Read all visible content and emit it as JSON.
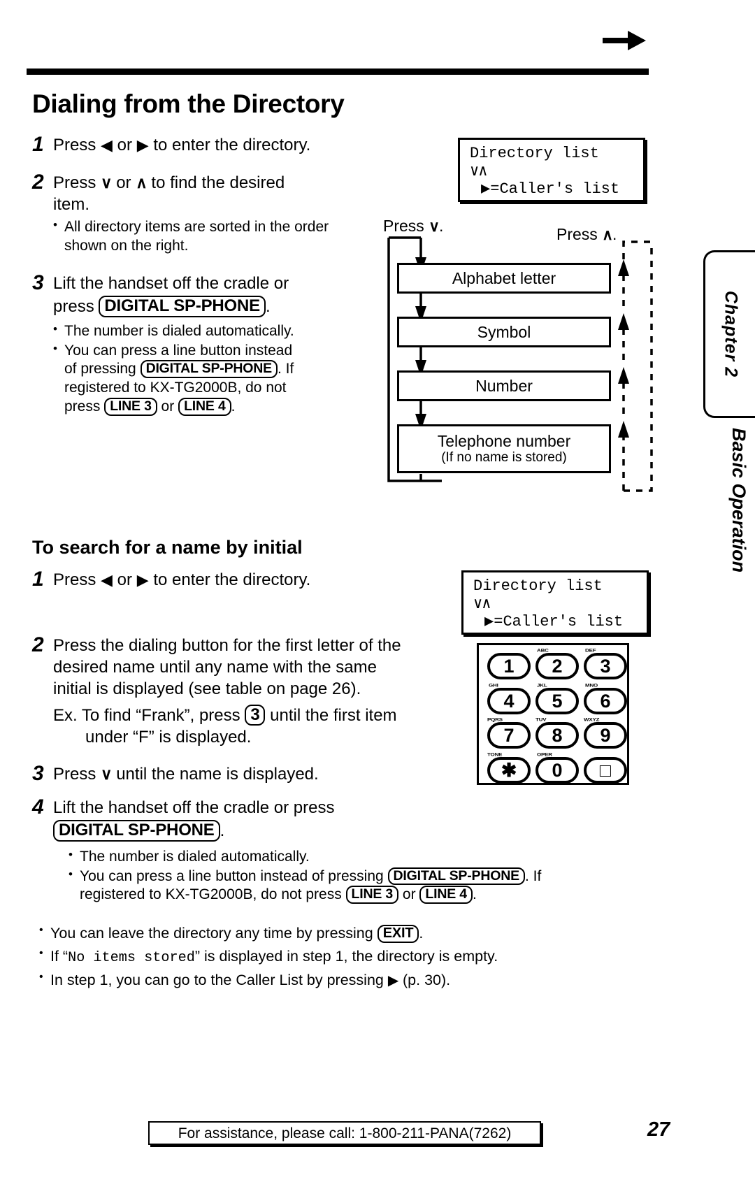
{
  "header": {
    "continue_arrow_icon": "right-arrow-icon"
  },
  "title": "Dialing from the Directory",
  "steps": [
    {
      "num": "1",
      "pre": "Press ",
      "mid": " or ",
      "post": " to enter the directory.",
      "icon_left": "◀",
      "icon_right": "▶"
    },
    {
      "num": "2",
      "line1_pre": "Press ",
      "line1_mid": " or ",
      "line1_post": " to find the desired",
      "line2": "item.",
      "icon_down": "∨",
      "icon_up": "∧",
      "bullets": [
        "All directory items are sorted in the order shown on the right."
      ]
    },
    {
      "num": "3",
      "line1": "Lift the handset off the cradle or",
      "line2_pre": "press ",
      "key": "DIGITAL SP-PHONE",
      "line2_post": ".",
      "bullets": [
        "The number is dialed automatically.",
        "You can press a line button instead of pressing DIGITAL SP-PHONE. If registered to KX-TG2000B, do not press LINE 3 or LINE 4."
      ]
    }
  ],
  "lcd_top": {
    "line1": "Directory list",
    "line2": "∨∧",
    "line3": "▶=Caller's list"
  },
  "flow": {
    "label_down": "Press",
    "label_down_icon": "∨",
    "label_down_suffix": ".",
    "label_up": "Press",
    "label_up_icon": "∧",
    "label_up_suffix": ".",
    "boxes": [
      {
        "title": "Alphabet letter",
        "sub": ""
      },
      {
        "title": "Symbol",
        "sub": ""
      },
      {
        "title": "Number",
        "sub": ""
      },
      {
        "title": "Telephone number",
        "sub": "(If no name is stored)"
      }
    ]
  },
  "section2": {
    "heading": "To search for a name by initial",
    "steps": [
      {
        "num": "1",
        "pre": "Press ",
        "mid": " or ",
        "post": " to enter the directory.",
        "icon_left": "◀",
        "icon_right": "▶"
      },
      {
        "num": "2",
        "line1": "Press the dialing button for the first letter of the",
        "line2": "desired name until any name with the same",
        "line3": "initial is displayed (see table on page 26).",
        "ex_pre": "Ex. To find “Frank”, press ",
        "ex_key": "3",
        "ex_mid": " until the first item",
        "ex_line2": "under “F” is displayed."
      },
      {
        "num": "3",
        "pre": "Press ",
        "icon": "∨",
        "post": " until the name is displayed."
      },
      {
        "num": "4",
        "line1": "Lift the handset off the cradle or press",
        "key": "DIGITAL SP-PHONE",
        "line2_post": ".",
        "bullets": [
          "The number is dialed automatically.",
          "You can press a line button instead of pressing DIGITAL SP-PHONE. If registered to KX-TG2000B, do not press LINE 3 or LINE 4."
        ]
      }
    ]
  },
  "lcd_bottom": {
    "line1": "Directory list",
    "line2": "∨∧",
    "line3": "▶=Caller's list"
  },
  "keypad": {
    "keys": [
      {
        "digit": "1",
        "letters": ""
      },
      {
        "digit": "2",
        "letters": "ABC"
      },
      {
        "digit": "3",
        "letters": "DEF"
      },
      {
        "digit": "4",
        "letters": "GHI"
      },
      {
        "digit": "5",
        "letters": "JKL"
      },
      {
        "digit": "6",
        "letters": "MNO"
      },
      {
        "digit": "7",
        "letters": "PQRS"
      },
      {
        "digit": "8",
        "letters": "TUV"
      },
      {
        "digit": "9",
        "letters": "WXYZ"
      },
      {
        "digit": "✱",
        "letters": "TONE"
      },
      {
        "digit": "0",
        "letters": "OPER"
      },
      {
        "digit": "□",
        "letters": ""
      }
    ]
  },
  "bullet_texts": {
    "key_labels": {
      "digital_sp_phone": "DIGITAL SP-PHONE",
      "line3": "LINE 3",
      "line4": "LINE 4",
      "exit": "EXIT",
      "key3": "3"
    },
    "s3_b2_a": "You can press a line button instead",
    "s3_b2_b": "of pressing ",
    "s3_b2_c": ". If",
    "s3_b2_d": "registered to KX-TG2000B, do not",
    "s3_b2_e": "press ",
    "s3_b2_f": " or ",
    "s3_b2_g": "."
  },
  "final_notes": {
    "n1_pre": "You can leave the directory any time by pressing ",
    "n1_key": "EXIT",
    "n1_post": ".",
    "n2_pre": "If “",
    "n2_mono": "No items stored",
    "n2_post": "” is displayed in step 1, the directory is empty.",
    "n3_pre": "In step 1, you can go to the Caller List by pressing ",
    "n3_icon": "▶",
    "n3_post": " (p. 30)."
  },
  "s4_notes": {
    "b1": "The number is dialed automatically.",
    "b2_pre": "You can press a line button instead of pressing ",
    "b2_mid": ". If",
    "b2_line2_pre": "registered to KX-TG2000B, do not press ",
    "b2_or": " or ",
    "b2_end": "."
  },
  "sidebar": {
    "chapter": "Chapter 2",
    "section": "Basic Operation"
  },
  "footer": {
    "assistance": "For assistance, please call: 1-800-211-PANA(7262)",
    "page_number": "27"
  }
}
